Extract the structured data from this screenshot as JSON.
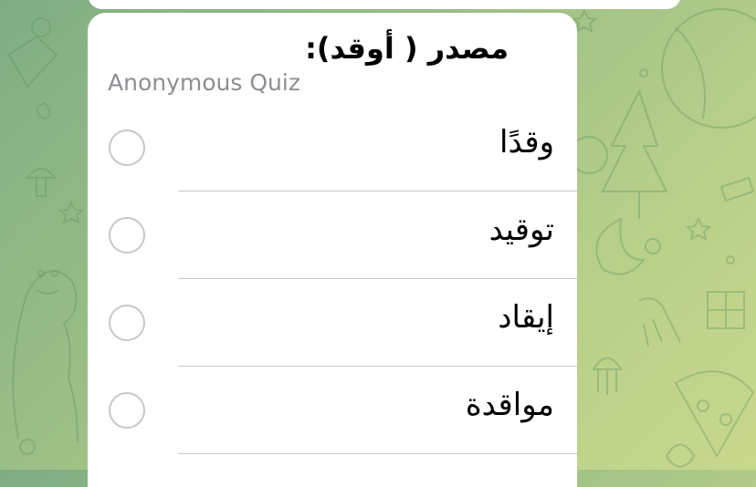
{
  "poll": {
    "question": "مصدر ( أوقد):",
    "type_label": "Anonymous Quiz",
    "options": [
      {
        "text": "وقدًا"
      },
      {
        "text": "توقيد"
      },
      {
        "text": "إيقاد"
      },
      {
        "text": "مواقدة"
      }
    ]
  },
  "colors": {
    "background_start": "#7fae84",
    "background_end": "#c8d88c",
    "bubble": "#ffffff",
    "subtitle_text": "#8e8e93",
    "radio_border": "#c7c7cc",
    "divider": "#c8c7cc"
  },
  "icons": [
    "radio-button-empty-icon"
  ]
}
